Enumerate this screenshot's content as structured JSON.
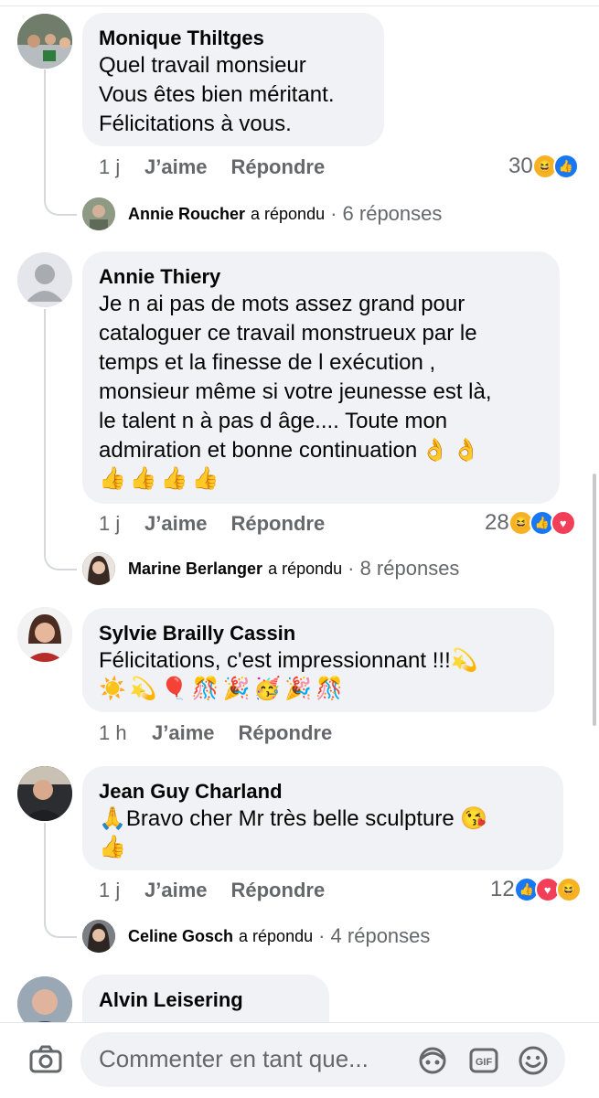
{
  "comments": [
    {
      "author": "Monique Thiltges",
      "text": "Quel travail monsieur\nVous êtes bien méritant.\nFélicitations à vous.",
      "time": "1 j",
      "like_label": "J’aime",
      "reply_label": "Répondre",
      "reaction_count": "30",
      "reply_preview": {
        "name": "Annie Roucher",
        "verb": "a répondu",
        "count": "· 6 réponses"
      }
    },
    {
      "author": "Annie Thiery",
      "text": "Je n ai pas de mots assez grand pour\ncataloguer ce travail monstrueux par le\ntemps et la finesse de l exécution ,\nmonsieur même si votre jeunesse est là,\nle talent n à pas d âge.... Toute mon\nadmiration et bonne continuation",
      "emoji_line1": "👌👌",
      "emoji_line2": "👍👍👍👍",
      "time": "1 j",
      "like_label": "J’aime",
      "reply_label": "Répondre",
      "reaction_count": "28",
      "reply_preview": {
        "name": "Marine Berlanger",
        "verb": "a répondu",
        "count": "· 8 réponses"
      }
    },
    {
      "author": "Sylvie Brailly Cassin",
      "text": "Félicitations, c'est impressionnant !!!💫",
      "emoji_line": "☀️💫🎈🎊🎉🥳🎉🎊",
      "time": "1 h",
      "like_label": "J’aime",
      "reply_label": "Répondre"
    },
    {
      "author": "Jean Guy Charland",
      "text": "🙏Bravo cher Mr très belle sculpture 😘",
      "emoji_line": "👍",
      "time": "1 j",
      "like_label": "J’aime",
      "reply_label": "Répondre",
      "reaction_count": "12",
      "reply_preview": {
        "name": "Celine Gosch",
        "verb": "a répondu",
        "count": "· 4 réponses"
      }
    },
    {
      "author": "Alvin Leisering"
    }
  ],
  "composer": {
    "placeholder": "Commenter en tant que..."
  },
  "colors": {
    "accent": "#1877f2",
    "bubble": "#f0f2f5",
    "muted": "#65676b"
  },
  "icons": [
    "camera-icon",
    "avatar-sticker-icon",
    "gif-icon",
    "emoji-icon"
  ]
}
